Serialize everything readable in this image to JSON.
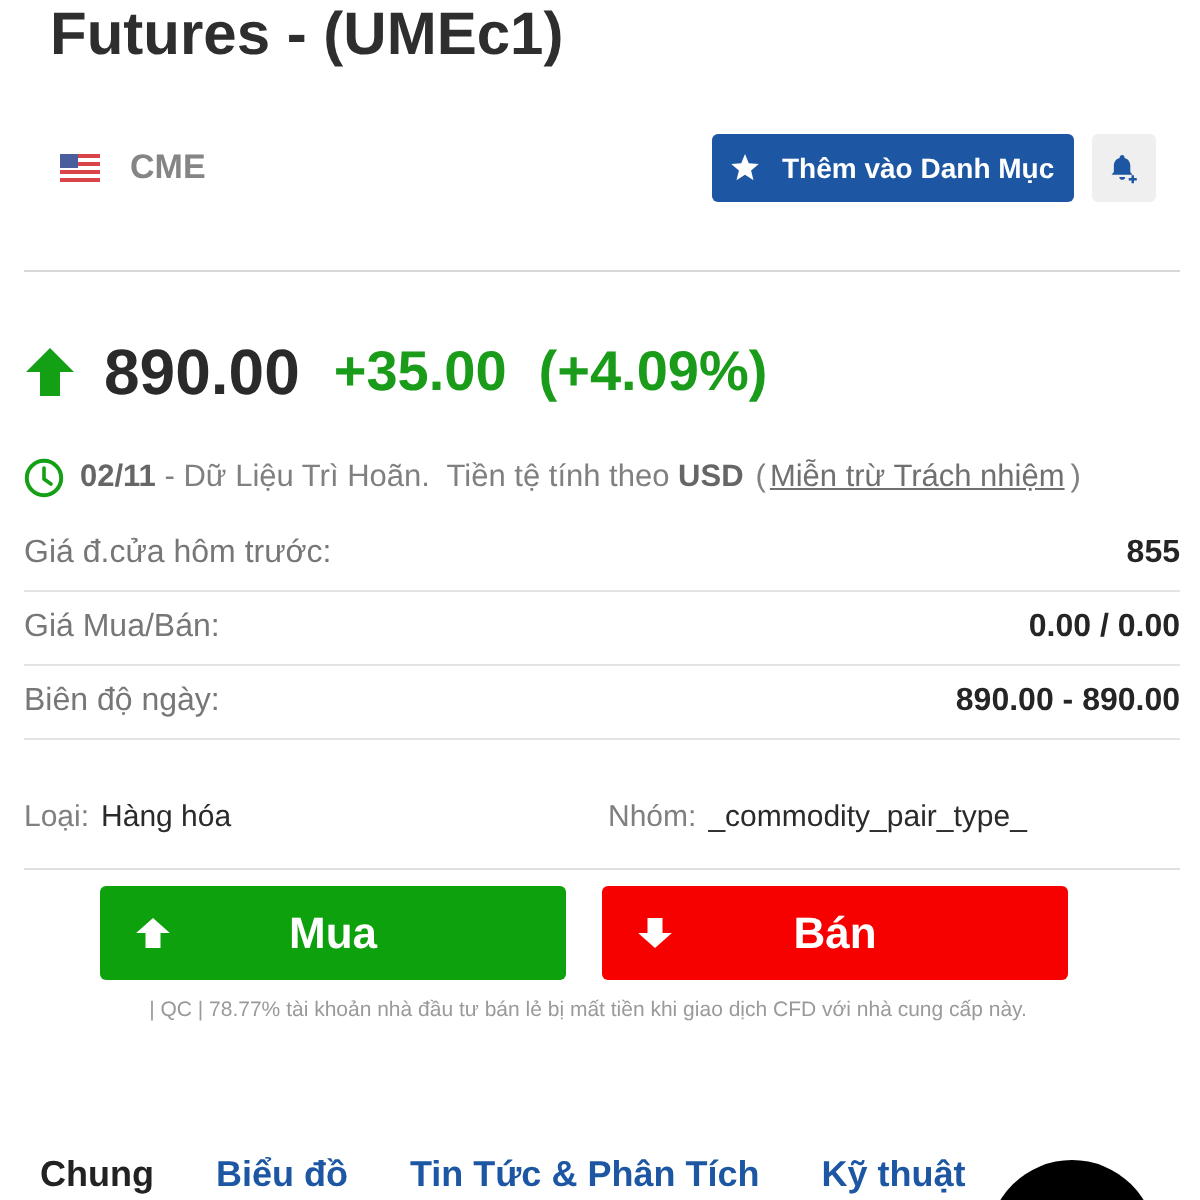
{
  "title": "Futures - (UMEc1)",
  "exchange": {
    "name": "CME"
  },
  "actions": {
    "watchlist_button": "Thêm vào Danh Mục"
  },
  "quote": {
    "rising": true,
    "price": "890.00",
    "change": "+35.00",
    "change_percent": "(+4.09%)"
  },
  "status": {
    "note": "**02/11** - Dữ Liệu Trì Hoãn.  Tiền tệ tính theo **USD**",
    "paren_open": "(",
    "link": "Miễn trừ Trách nhiệm",
    "paren_close": ")"
  },
  "stats": [
    {
      "label": "Giá đ.cửa hôm trước:",
      "value": "855"
    },
    {
      "label": "Giá Mua/Bán:",
      "value": "0.00 / 0.00"
    },
    {
      "label": "Biên độ ngày:",
      "value": "890.00 - 890.00"
    }
  ],
  "details": [
    {
      "label": "Loại:",
      "value": "Hàng hóa"
    },
    {
      "label": "Nhóm:",
      "value": "_commodity_pair_type_"
    }
  ],
  "trade_buttons": [
    {
      "kind": "buy",
      "label": "Mua"
    },
    {
      "kind": "sell",
      "label": "Bán"
    }
  ],
  "risk_notice": "| QC | 78.77% tài khoản nhà đầu tư bán lẻ bị mất tiền khi giao dịch CFD với nhà cung cấp này.",
  "tabs": [
    {
      "label": "Chung",
      "selected": true
    },
    {
      "label": "Biểu đồ",
      "selected": false
    },
    {
      "label": "Tin Tức & Phân Tích",
      "selected": false
    },
    {
      "label": "Kỹ thuật",
      "selected": false
    }
  ]
}
